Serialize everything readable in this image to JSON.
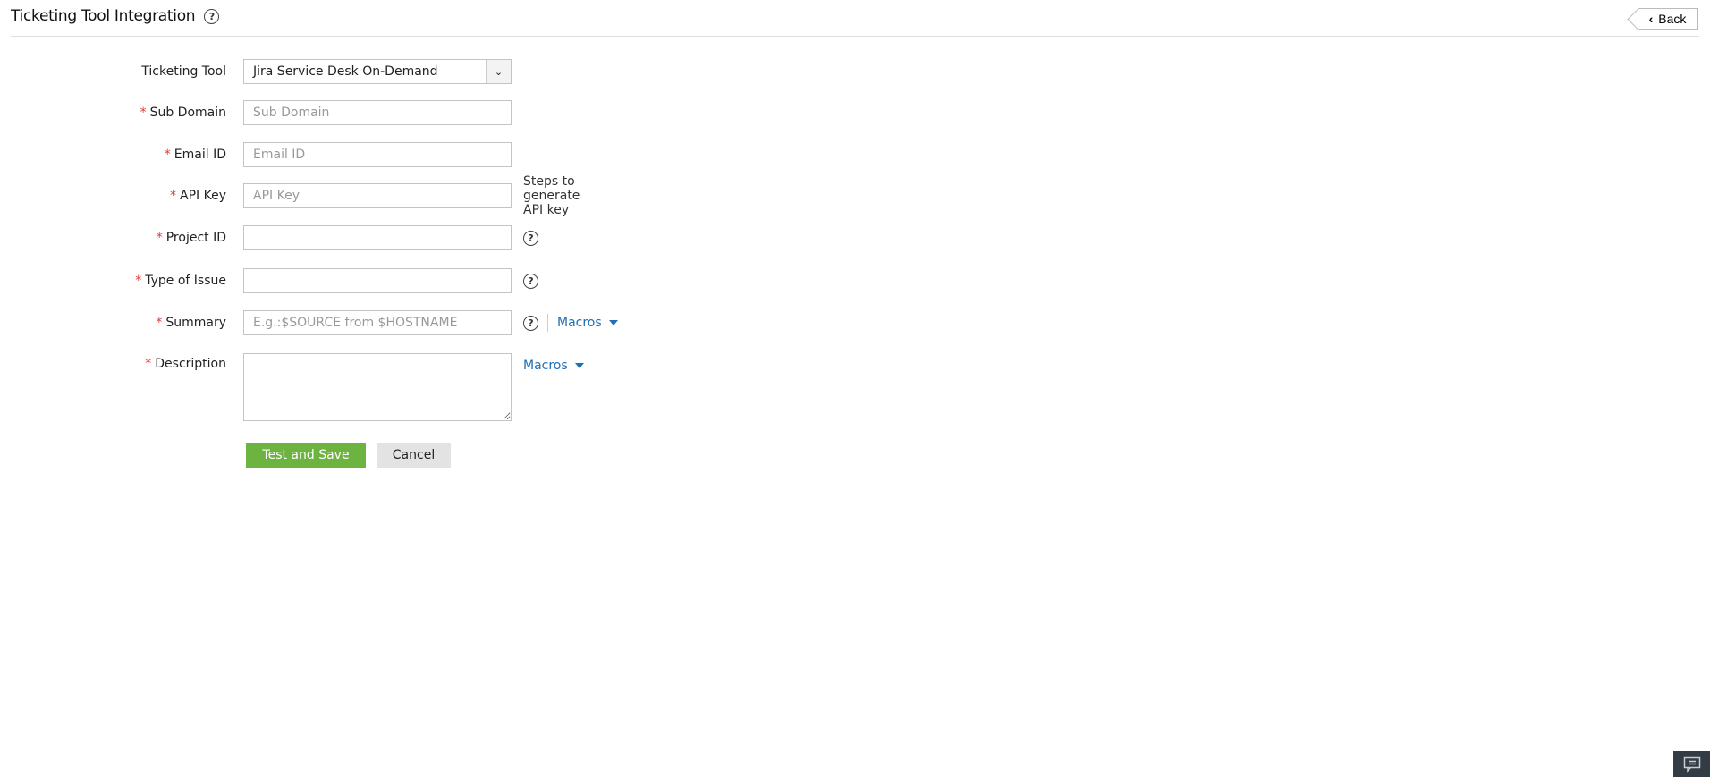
{
  "header": {
    "title": "Ticketing Tool Integration",
    "back_label": "Back"
  },
  "form": {
    "ticketing_tool": {
      "label": "Ticketing Tool",
      "value": "Jira Service Desk On-Demand"
    },
    "sub_domain": {
      "label": "Sub Domain",
      "placeholder": "Sub Domain"
    },
    "email_id": {
      "label": "Email ID",
      "placeholder": "Email ID"
    },
    "api_key": {
      "label": "API Key",
      "placeholder": "API Key",
      "link": "Steps to generate API key"
    },
    "project_id": {
      "label": "Project ID"
    },
    "type_of_issue": {
      "label": "Type of Issue"
    },
    "summary": {
      "label": "Summary",
      "placeholder": "E.g.:$SOURCE from $HOSTNAME",
      "macros": "Macros"
    },
    "description": {
      "label": "Description",
      "macros": "Macros"
    },
    "required_mark": "*",
    "help_mark": "?"
  },
  "actions": {
    "save": "Test and Save",
    "cancel": "Cancel"
  }
}
